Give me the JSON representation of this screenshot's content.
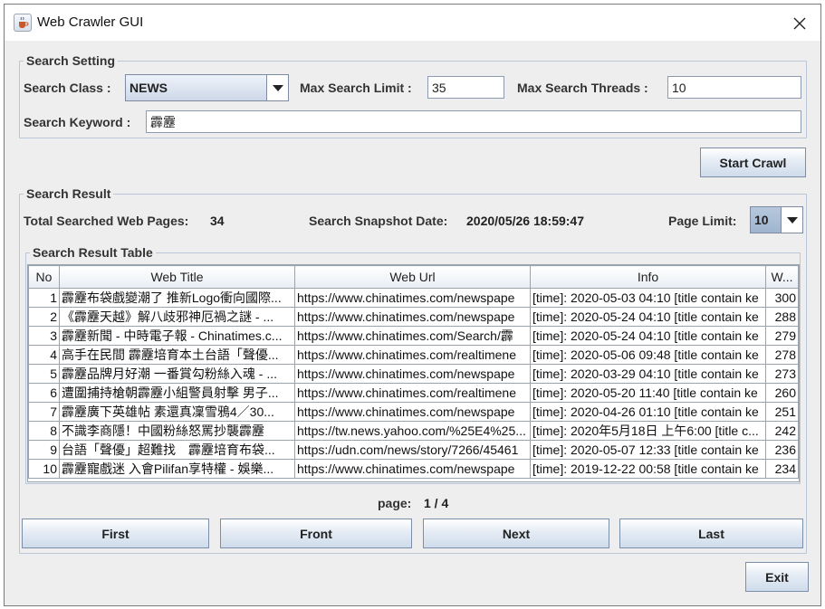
{
  "window": {
    "title": "Web Crawler GUI"
  },
  "search_setting": {
    "legend": "Search Setting",
    "class_label": "Search Class :",
    "class_value": "NEWS",
    "max_limit_label": "Max Search Limit :",
    "max_limit_value": "35",
    "max_threads_label": "Max Search Threads :",
    "max_threads_value": "10",
    "keyword_label": "Search Keyword :",
    "keyword_value": "霹靂"
  },
  "start_button": "Start Crawl",
  "search_result": {
    "legend": "Search Result",
    "total_label": "Total Searched Web Pages:",
    "total_value": "34",
    "snapshot_label": "Search Snapshot Date:",
    "snapshot_value": "2020/05/26 18:59:47",
    "page_limit_label": "Page Limit:",
    "page_limit_value": "10",
    "table_legend": "Search Result Table"
  },
  "table": {
    "headers": [
      "No",
      "Web Title",
      "Web Url",
      "Info",
      "W..."
    ],
    "rows": [
      [
        "1",
        "霹靂布袋戲變潮了 推新Logo衝向國際...",
        "https://www.chinatimes.com/newspape",
        "[time]: 2020-05-03 04:10 [title contain ke",
        "300"
      ],
      [
        "2",
        "《霹靂天越》解八歧邪神厄禍之謎 - ...",
        "https://www.chinatimes.com/newspape",
        "[time]: 2020-05-24 04:10 [title contain ke",
        "288"
      ],
      [
        "3",
        "霹靂新聞 - 中時電子報 - Chinatimes.c...",
        "https://www.chinatimes.com/Search/霹",
        "[time]: 2020-05-24 04:10 [title contain ke",
        "279"
      ],
      [
        "4",
        "高手在民間 霹靂培育本土台語「聲優...",
        "https://www.chinatimes.com/realtimene",
        "[time]: 2020-05-06 09:48 [title contain ke",
        "278"
      ],
      [
        "5",
        "霹靂品牌月好潮 一番賞勾粉絲入魂 - ...",
        "https://www.chinatimes.com/newspape",
        "[time]: 2020-03-29 04:10 [title contain ke",
        "273"
      ],
      [
        "6",
        "遭圍捕持槍朝霹靂小組警員射擊 男子...",
        "https://www.chinatimes.com/realtimene",
        "[time]: 2020-05-20 11:40 [title contain ke",
        "260"
      ],
      [
        "7",
        "霹靂廣下英雄帖 素還真凜雪鴉4／30...",
        "https://www.chinatimes.com/newspape",
        "[time]: 2020-04-26 01:10 [title contain ke",
        "251"
      ],
      [
        "8",
        "不識李商隱！中國粉絲怒罵抄襲霹靂",
        "https://tw.news.yahoo.com/%25E4%25...",
        "[time]: 2020年5月18日 上午6:00 [title c...",
        "242"
      ],
      [
        "9",
        "台語「聲優」超難找　霹靂培育布袋...",
        "https://udn.com/news/story/7266/45461",
        "[time]: 2020-05-07 12:33 [title contain ke",
        "236"
      ],
      [
        "10",
        "霹靂寵戲迷 入會Pilifan享特權 - 娛樂...",
        "https://www.chinatimes.com/newspape",
        "[time]: 2019-12-22 00:58 [title contain ke",
        "234"
      ]
    ]
  },
  "pagination": {
    "label": "page:",
    "value": "1 / 4",
    "first": "First",
    "front": "Front",
    "next": "Next",
    "last": "Last"
  },
  "exit_button": "Exit",
  "icons": {
    "app": "java-cup-icon",
    "close": "close-icon",
    "dropdown": "chevron-down-icon"
  }
}
